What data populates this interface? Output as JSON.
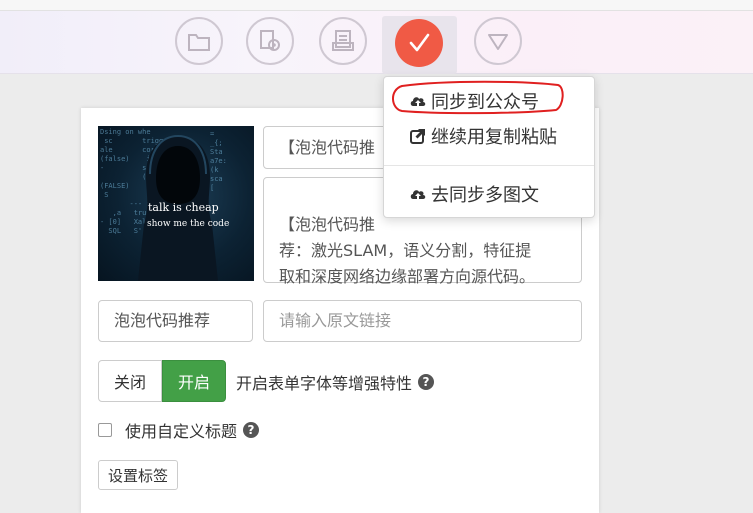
{
  "toolbar": {
    "buttons": [
      {
        "icon": "folder-icon"
      },
      {
        "icon": "settings-doc-icon"
      },
      {
        "icon": "clipboard-icon"
      },
      {
        "icon": "check-icon",
        "active": true,
        "color": "#f05a45"
      },
      {
        "icon": "triangle-down-icon"
      }
    ]
  },
  "dropdown": {
    "items": [
      {
        "label": "同步到公众号",
        "icon": "cloud-upload-icon",
        "highlighted": true,
        "annotation_color": "#e02020"
      },
      {
        "label": "继续用复制粘贴",
        "icon": "external-link-icon"
      },
      {
        "label": "去同步多图文",
        "icon": "cloud-upload-icon"
      }
    ]
  },
  "article": {
    "cover": {
      "text_line1": "talk is cheap",
      "text_line2": "show me the code"
    },
    "title": "【泡泡代码推",
    "summary": "【泡泡代码推\n荐：激光SLAM，语义分割，特征提\n取和深度网络边缘部署方向源代码。",
    "author": "泡泡代码推荐",
    "source_url_placeholder": "请输入原文链接",
    "toggle": {
      "off_label": "关闭",
      "on_label": "开启",
      "description": "开启表单字体等增强特性",
      "accent": "#43a047"
    },
    "custom_title_label": "使用自定义标题",
    "tags_button": "设置标签"
  }
}
